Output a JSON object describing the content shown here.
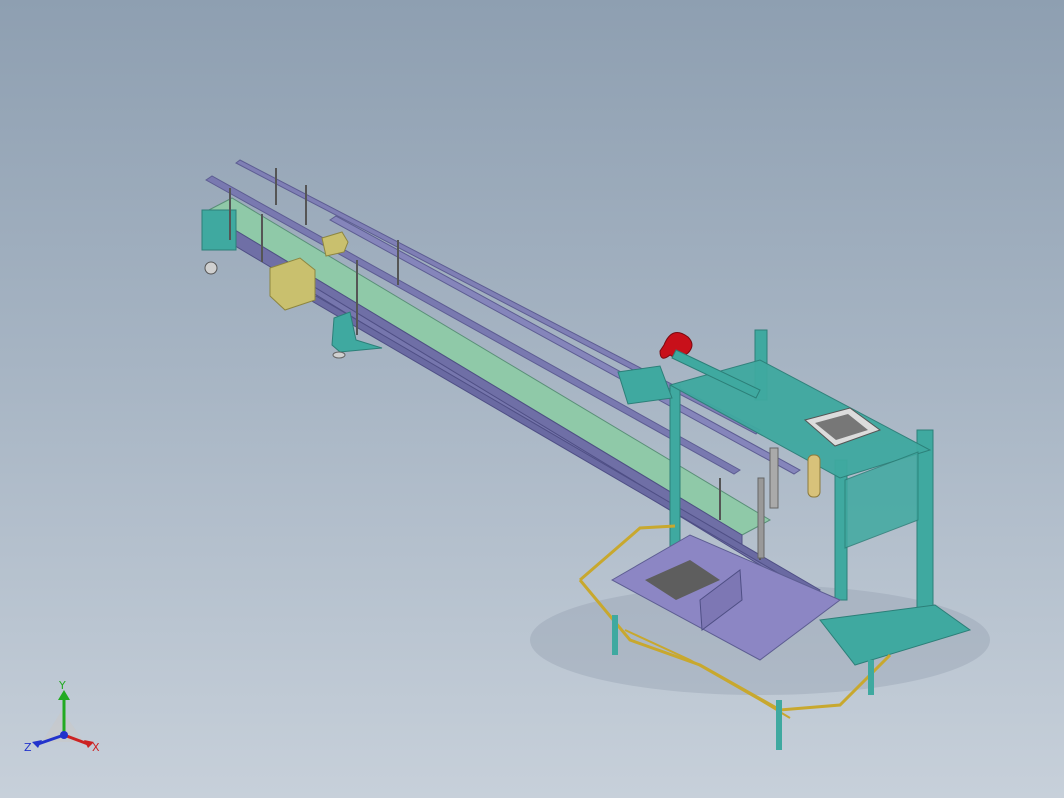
{
  "viewport": {
    "background_top": "#8e9fb1",
    "background_bottom": "#c7d0da"
  },
  "model": {
    "description_icon": "cad-conveyor-assembly",
    "colors": {
      "frame": "#3fa9a0",
      "frame_dark": "#2c7f78",
      "rail": "#7f7fb5",
      "rail_dark": "#5d5d92",
      "belt": "#8fc9a8",
      "plate": "#8c86c4",
      "yellow_rail": "#c8a82e",
      "motor": "#c9c06e",
      "red_part": "#c8101a"
    }
  },
  "triad": {
    "y_label": "Y",
    "x_label": "X",
    "z_label": "Z",
    "y_color": "#22aa22",
    "x_color": "#cc2222",
    "z_color": "#2233cc"
  }
}
